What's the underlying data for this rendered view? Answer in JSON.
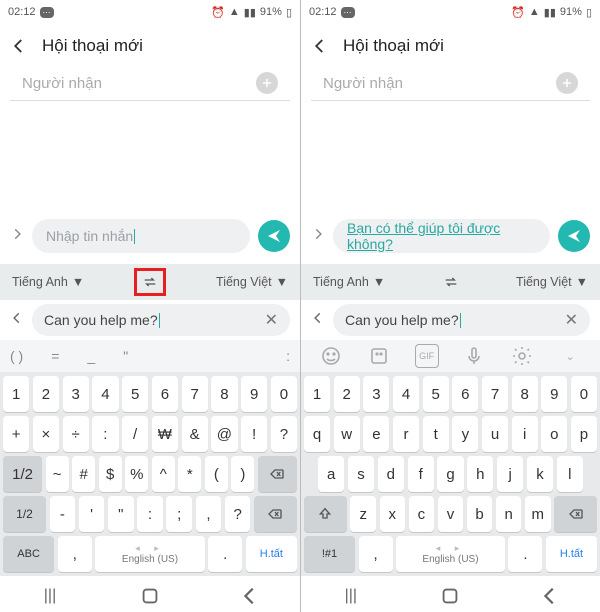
{
  "status": {
    "time": "02:12",
    "battery": "91%"
  },
  "header": {
    "title": "Hội thoại mới"
  },
  "recipient": {
    "placeholder": "Người nhận"
  },
  "message": {
    "placeholder_left": "Nhập tin nhắn",
    "translated_right": "Bạn có thể giúp tôi được không?"
  },
  "translate": {
    "source_lang": "Tiếng Anh",
    "target_lang": "Tiếng Việt",
    "input_text": "Can you help me?"
  },
  "suggestions_left": {
    "s1": "( )",
    "s2": "=",
    "s3": "_",
    "s4": "\"",
    "s5": ":"
  },
  "keyboard_left": {
    "r1": [
      "1",
      "2",
      "3",
      "4",
      "5",
      "6",
      "7",
      "8",
      "9",
      "0"
    ],
    "r2": [
      "+",
      "×",
      "÷",
      ":",
      "/",
      "₩",
      "&",
      "@",
      "!",
      "?"
    ],
    "r3": [
      "~",
      "#",
      "$",
      "%",
      "^",
      "*",
      "(",
      ")"
    ],
    "r4_mode": "1/2",
    "r4": [
      "-",
      "'",
      "\"",
      ":",
      ";",
      ",",
      "?"
    ],
    "bottom_mode": "ABC",
    "space": "English (US)",
    "right_action": "H.tất"
  },
  "keyboard_right": {
    "r1": [
      "1",
      "2",
      "3",
      "4",
      "5",
      "6",
      "7",
      "8",
      "9",
      "0"
    ],
    "r2": [
      "q",
      "w",
      "e",
      "r",
      "t",
      "y",
      "u",
      "i",
      "o",
      "p"
    ],
    "r3": [
      "a",
      "s",
      "d",
      "f",
      "g",
      "h",
      "j",
      "k",
      "l"
    ],
    "r4": [
      "z",
      "x",
      "c",
      "v",
      "b",
      "n",
      "m"
    ],
    "bottom_mode": "!#1",
    "space": "English (US)",
    "right_action": "H.tất"
  }
}
